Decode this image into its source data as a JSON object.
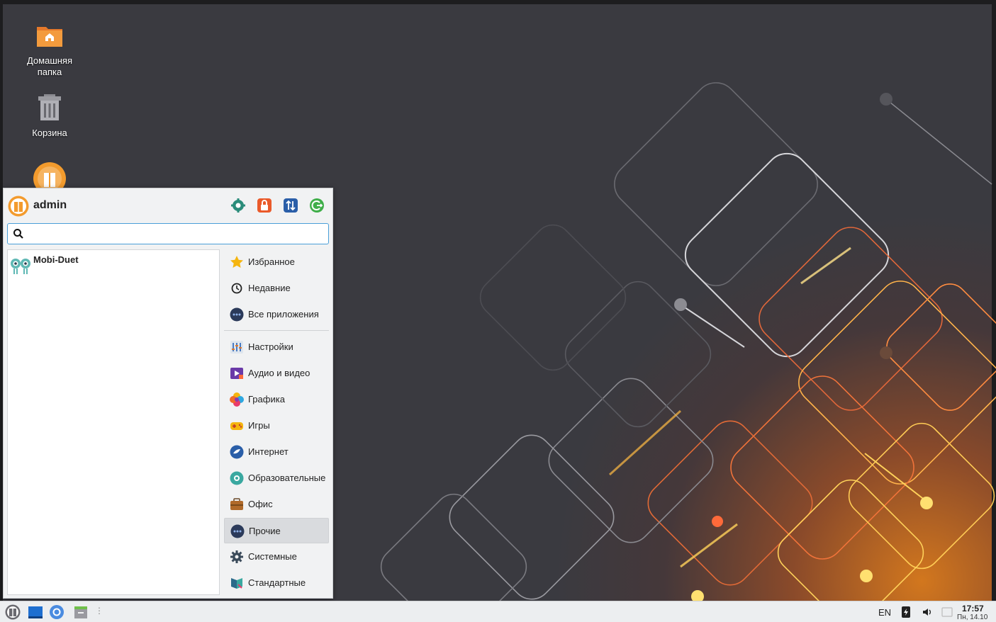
{
  "desktop": {
    "icons": [
      {
        "label": "Домашняя\nпапка",
        "icon": "home-folder-icon"
      },
      {
        "label": "Корзина",
        "icon": "trash-icon"
      },
      {
        "label": "",
        "icon": "vendor-logo-icon"
      }
    ]
  },
  "menu": {
    "user": "admin",
    "header_buttons": [
      "settings-icon",
      "lock-icon",
      "switch-user-icon",
      "logout-icon"
    ],
    "search": {
      "value": "",
      "placeholder": ""
    },
    "apps": [
      {
        "label": "Mobi-Duet",
        "icon": "mobi-duet-icon"
      }
    ],
    "categories": [
      {
        "label": "Избранное",
        "icon": "star-icon"
      },
      {
        "label": "Недавние",
        "icon": "clock-icon"
      },
      {
        "label": "Все приложения",
        "icon": "dots-icon"
      },
      {
        "label": "Настройки",
        "icon": "settings-panel-icon"
      },
      {
        "label": "Аудио и видео",
        "icon": "media-icon"
      },
      {
        "label": "Графика",
        "icon": "graphics-icon"
      },
      {
        "label": "Игры",
        "icon": "games-icon"
      },
      {
        "label": "Интернет",
        "icon": "internet-icon"
      },
      {
        "label": "Образовательные",
        "icon": "education-icon"
      },
      {
        "label": "Офис",
        "icon": "office-icon"
      },
      {
        "label": "Прочие",
        "icon": "dots-icon",
        "active": true
      },
      {
        "label": "Системные",
        "icon": "gear-icon"
      },
      {
        "label": "Стандартные",
        "icon": "accessories-icon"
      }
    ]
  },
  "taskbar": {
    "launchers": [
      "menu-logo-icon",
      "show-desktop-icon",
      "browser-icon",
      "file-manager-icon"
    ],
    "tray": {
      "lang": "EN",
      "time": "17:57",
      "date": "Пн, 14.10"
    }
  },
  "colors": {
    "accent": "#4a9fd8",
    "orange": "#f39b2d",
    "active_category": "#d9dbde"
  }
}
